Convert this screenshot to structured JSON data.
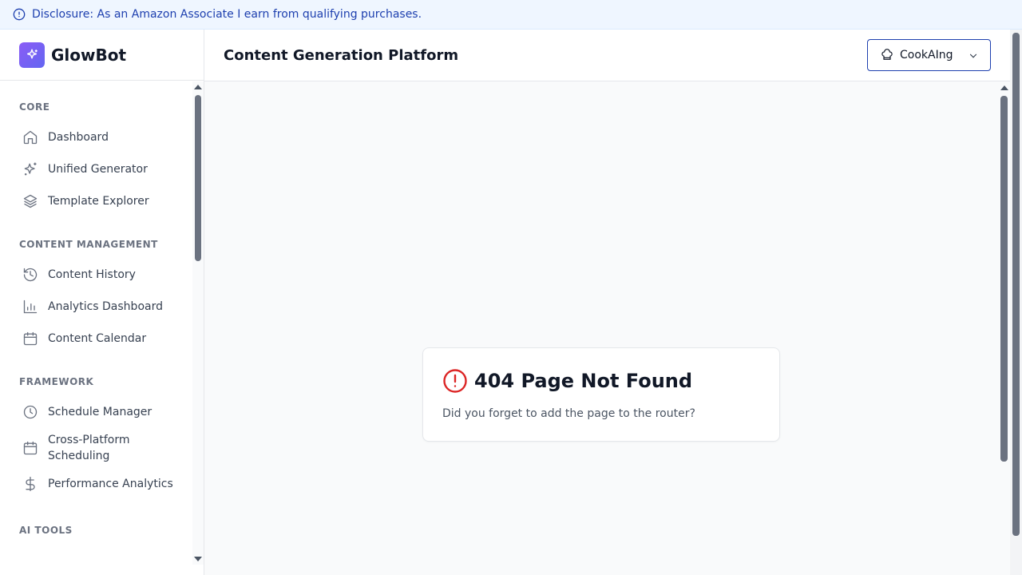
{
  "banner": {
    "text": "Disclosure: As an Amazon Associate I earn from qualifying purchases.",
    "icon": "info-circle-icon"
  },
  "brand": {
    "name": "GlowBot",
    "logo_icon": "sparkles-icon",
    "logo_gradient": [
      "#8b5cf6",
      "#6366f1"
    ]
  },
  "sidebar": {
    "sections": [
      {
        "title": "CORE",
        "items": [
          {
            "label": "Dashboard",
            "icon": "home-icon"
          },
          {
            "label": "Unified Generator",
            "icon": "sparkles-icon"
          },
          {
            "label": "Template Explorer",
            "icon": "layers-icon"
          }
        ]
      },
      {
        "title": "CONTENT MANAGEMENT",
        "items": [
          {
            "label": "Content History",
            "icon": "history-icon"
          },
          {
            "label": "Analytics Dashboard",
            "icon": "bar-chart-icon"
          },
          {
            "label": "Content Calendar",
            "icon": "calendar-icon"
          }
        ]
      },
      {
        "title": "FRAMEWORK",
        "items": [
          {
            "label": "Schedule Manager",
            "icon": "clock-icon"
          },
          {
            "label": "Cross-Platform Scheduling",
            "icon": "calendar-icon"
          },
          {
            "label": "Performance Analytics",
            "icon": "dollar-icon"
          }
        ]
      },
      {
        "title": "AI TOOLS",
        "items": []
      }
    ]
  },
  "header": {
    "title": "Content Generation Platform",
    "profile_label": "CookAIng",
    "profile_icon": "chef-hat-icon"
  },
  "error_card": {
    "title": "404 Page Not Found",
    "message": "Did you forget to add the page to the router?",
    "icon": "alert-circle-icon",
    "icon_color": "#dc2626"
  },
  "colors": {
    "banner_bg": "#eff6ff",
    "banner_text": "#1e40af",
    "accent_border": "#1e40af",
    "main_bg": "#f9fafb"
  }
}
